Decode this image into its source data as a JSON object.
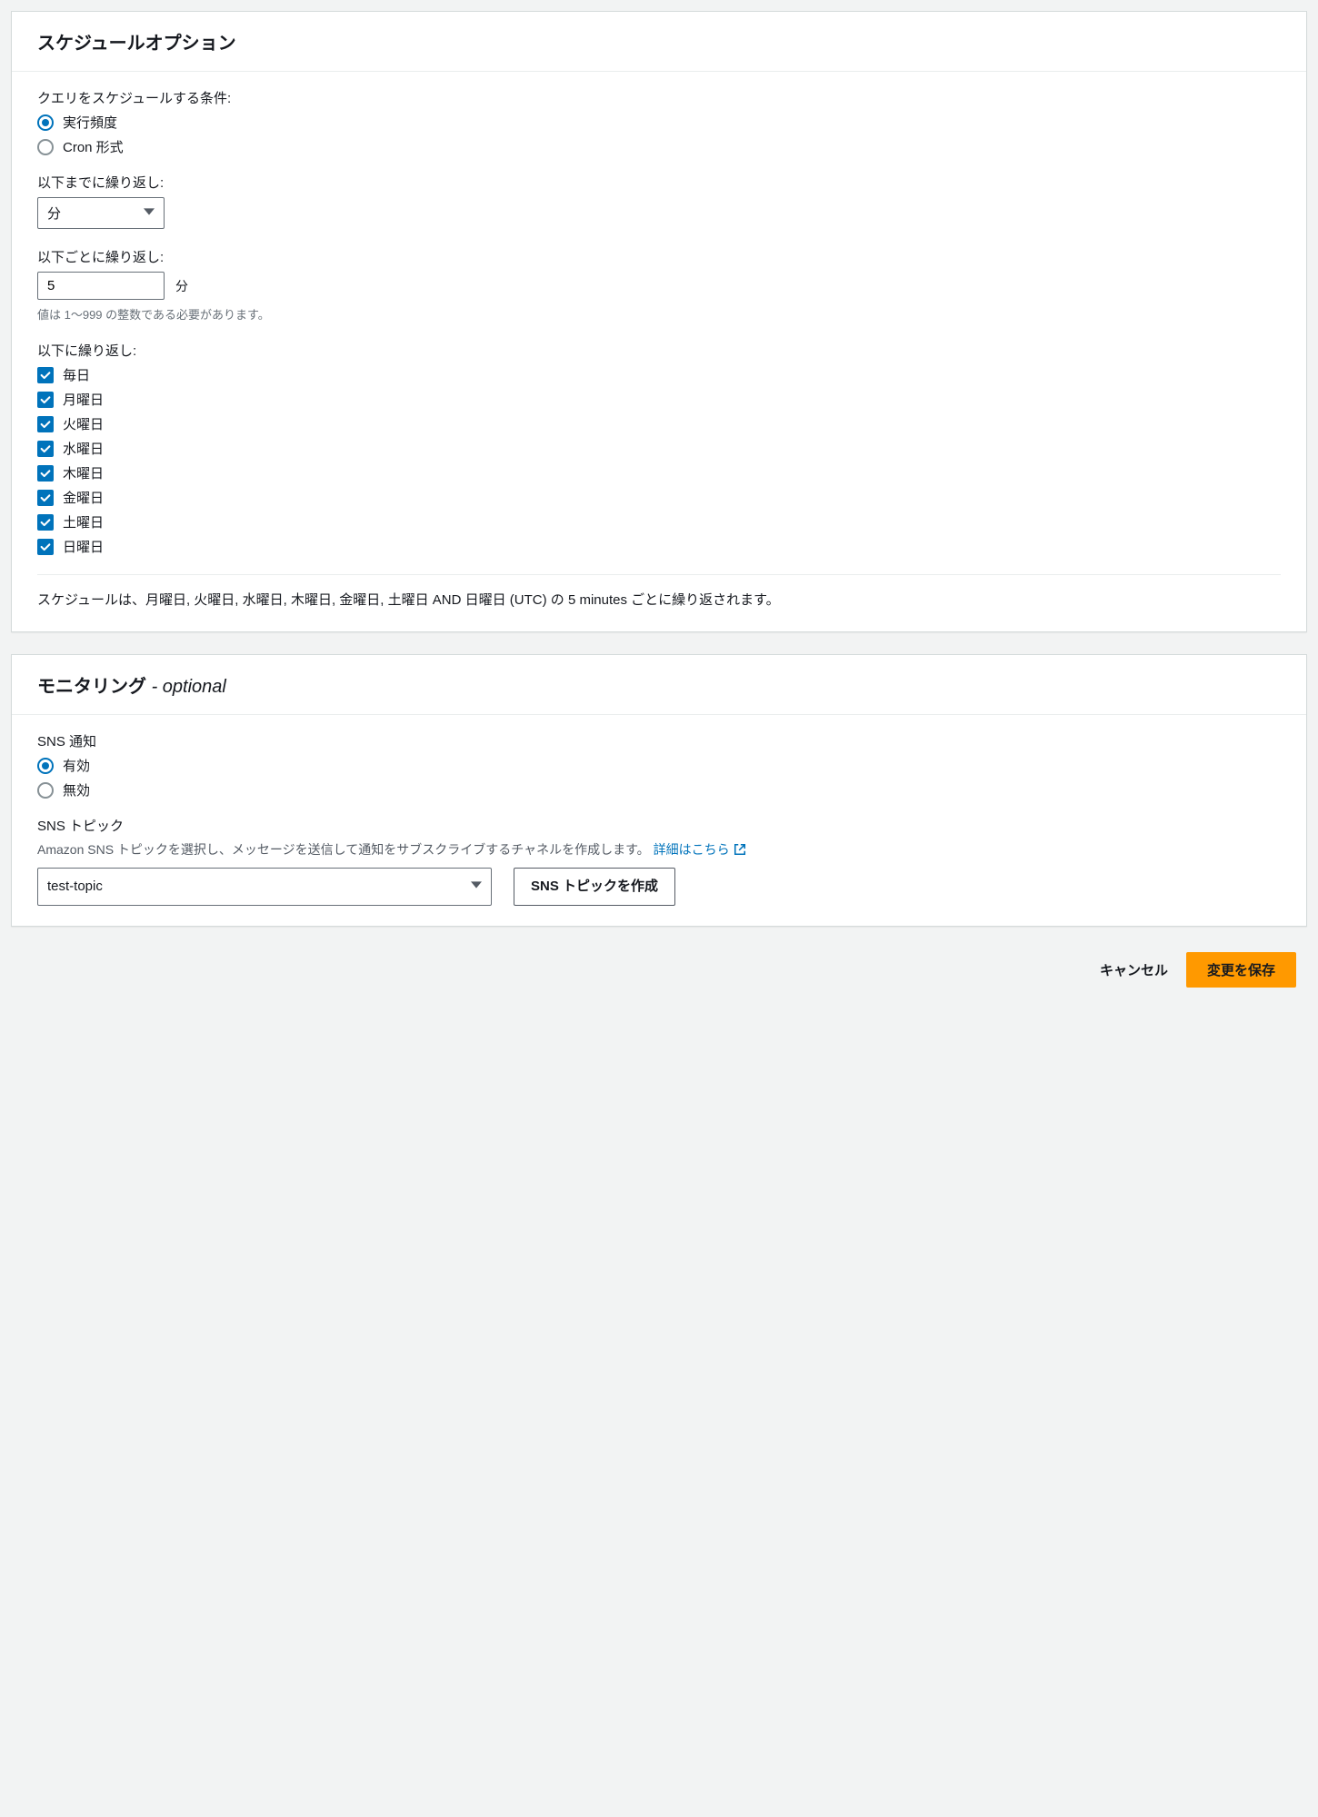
{
  "schedule": {
    "title": "スケジュールオプション",
    "condition_label": "クエリをスケジュールする条件:",
    "radios": {
      "frequency": "実行頻度",
      "cron": "Cron 形式"
    },
    "repeat_until": {
      "label": "以下までに繰り返し:",
      "value": "分"
    },
    "repeat_every": {
      "label": "以下ごとに繰り返し:",
      "value": "5",
      "unit": "分",
      "hint": "値は 1～999 の整数である必要があります。"
    },
    "repeat_on": {
      "label": "以下に繰り返し:",
      "days": [
        "毎日",
        "月曜日",
        "火曜日",
        "水曜日",
        "木曜日",
        "金曜日",
        "土曜日",
        "日曜日"
      ]
    },
    "summary": "スケジュールは、月曜日, 火曜日, 水曜日, 木曜日, 金曜日, 土曜日 AND 日曜日 (UTC) の 5 minutes ごとに繰り返されます。"
  },
  "monitoring": {
    "title_main": "モニタリング ",
    "title_optional": "- optional",
    "sns_notify_label": "SNS 通知",
    "radios": {
      "enabled": "有効",
      "disabled": "無効"
    },
    "sns_topic_label": "SNS トピック",
    "sns_topic_desc": "Amazon SNS トピックを選択し、メッセージを送信して通知をサブスクライブするチャネルを作成します。",
    "learn_more": "詳細はこちら",
    "topic_value": "test-topic",
    "create_topic_btn": "SNS トピックを作成"
  },
  "footer": {
    "cancel": "キャンセル",
    "save": "変更を保存"
  }
}
